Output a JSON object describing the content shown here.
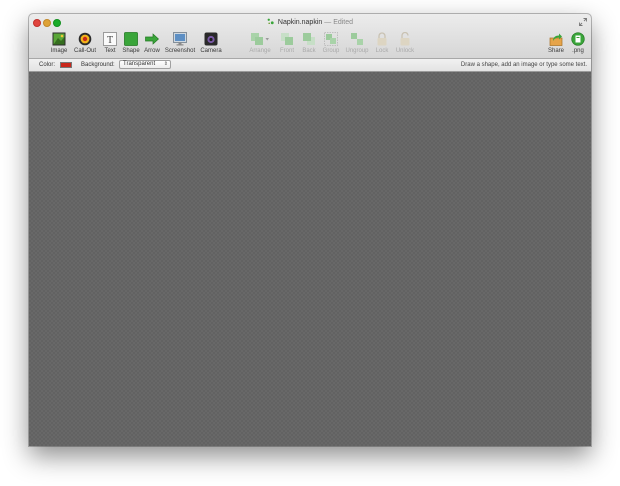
{
  "window": {
    "title": "Napkin.napkin",
    "title_separator": "—",
    "edited_label": "Edited"
  },
  "toolbar": {
    "insert_tools": [
      {
        "label": "Image",
        "icon": "image-icon"
      },
      {
        "label": "Call-Out",
        "icon": "callout-icon"
      },
      {
        "label": "Text",
        "icon": "text-icon"
      },
      {
        "label": "Shape",
        "icon": "shape-icon"
      },
      {
        "label": "Arrow",
        "icon": "arrow-icon"
      },
      {
        "label": "Screenshot",
        "icon": "screenshot-icon"
      },
      {
        "label": "Camera",
        "icon": "camera-icon"
      }
    ],
    "arrange_tools": [
      {
        "label": "Arrange",
        "icon": "arrange-icon",
        "enabled": false
      },
      {
        "label": "Front",
        "icon": "front-icon",
        "enabled": false
      },
      {
        "label": "Back",
        "icon": "back-icon",
        "enabled": false
      },
      {
        "label": "Group",
        "icon": "group-icon",
        "enabled": false
      },
      {
        "label": "Ungroup",
        "icon": "ungroup-icon",
        "enabled": false
      },
      {
        "label": "Lock",
        "icon": "lock-icon",
        "enabled": false
      },
      {
        "label": "Unlock",
        "icon": "unlock-icon",
        "enabled": false
      }
    ],
    "export_tools": [
      {
        "label": "Share",
        "icon": "share-icon"
      },
      {
        "label": ".png",
        "icon": "png-export-icon"
      }
    ]
  },
  "options": {
    "color_label": "Color:",
    "color_value": "#c8281c",
    "background_label": "Background:",
    "background_value": "Transparent",
    "hint": "Draw a shape, add an image or type some text."
  },
  "colors": {
    "canvas": "#626262",
    "accent_green": "#3aa53a",
    "close": "#e0443e",
    "minimize": "#dea236",
    "zoom": "#1aab29"
  }
}
